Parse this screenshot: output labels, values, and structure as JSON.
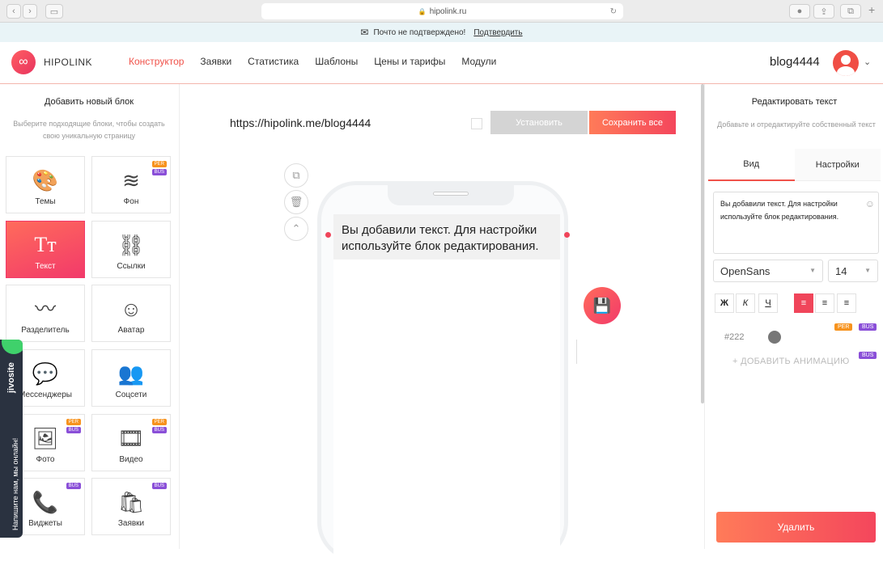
{
  "browser": {
    "address": "hipolink.ru",
    "lock_icon": "lock-icon"
  },
  "notice": {
    "text": "Почто не подтверждено!",
    "link": "Подтвердить"
  },
  "header": {
    "brand": "HIPOLINK",
    "nav": [
      "Конструктор",
      "Заявки",
      "Статистика",
      "Шаблоны",
      "Цены и тарифы",
      "Модули"
    ],
    "active_nav": "Конструктор",
    "username": "blog4444",
    "accent": "#f0524a"
  },
  "left": {
    "title": "Добавить новый блок",
    "subtitle": "Выберите подходящие блоки, чтобы создать свою уникальную страницу",
    "tiles": [
      {
        "label": "Темы",
        "icon": "palette-icon",
        "glyph": "🎨"
      },
      {
        "label": "Фон",
        "icon": "layers-icon",
        "glyph": "≋",
        "badges": [
          "PER",
          "BUS"
        ]
      },
      {
        "label": "Текст",
        "icon": "text-icon",
        "glyph": "Tт"
      },
      {
        "label": "Ссылки",
        "icon": "link-icon",
        "glyph": "🔗"
      },
      {
        "label": "Разделитель",
        "icon": "wave-icon",
        "glyph": "〰"
      },
      {
        "label": "Аватар",
        "icon": "avatar-icon",
        "glyph": "👤"
      },
      {
        "label": "Мессенджеры",
        "icon": "chat-icon",
        "glyph": "💬"
      },
      {
        "label": "Соцсети",
        "icon": "network-icon",
        "glyph": "👥"
      },
      {
        "label": "Фото",
        "icon": "photo-icon",
        "glyph": "🖼",
        "badges": [
          "PER",
          "BUS"
        ]
      },
      {
        "label": "Видео",
        "icon": "video-icon",
        "glyph": "🎞",
        "badges": [
          "PER",
          "BUS"
        ]
      },
      {
        "label": "Виджеты",
        "icon": "phone-icon",
        "glyph": "📞",
        "badges": [
          "BUS"
        ]
      },
      {
        "label": "Заявки",
        "icon": "bag-icon",
        "glyph": "🛍",
        "badges": [
          "BUS"
        ]
      }
    ],
    "badge_per": "PER",
    "badge_bus": "BUS"
  },
  "jivo": {
    "brand": "jivosite",
    "text": "Напишите нам, мы онлайн!"
  },
  "center": {
    "url": "https://hipolink.me/blog4444",
    "install_label": "Установить",
    "save_label": "Сохранить все",
    "block_text": "Вы добавили текст. Для настройки используйте блок редактирования."
  },
  "right": {
    "title": "Редактировать текст",
    "subtitle": "Добавьте и отредактируйте собственный текст",
    "tab_view": "Вид",
    "tab_settings": "Настройки",
    "text_value": "Вы добавили текст. Для настройки используйте блок редактирования.",
    "font": "OpenSans",
    "size": "14",
    "bold": "Ж",
    "italic": "К",
    "underline": "Ч",
    "color_hex": "#222",
    "badge_per": "PER",
    "badge_bus": "BUS",
    "add_animation": "+ ДОБАВИТЬ АНИМАЦИЮ",
    "delete_label": "Удалить"
  }
}
